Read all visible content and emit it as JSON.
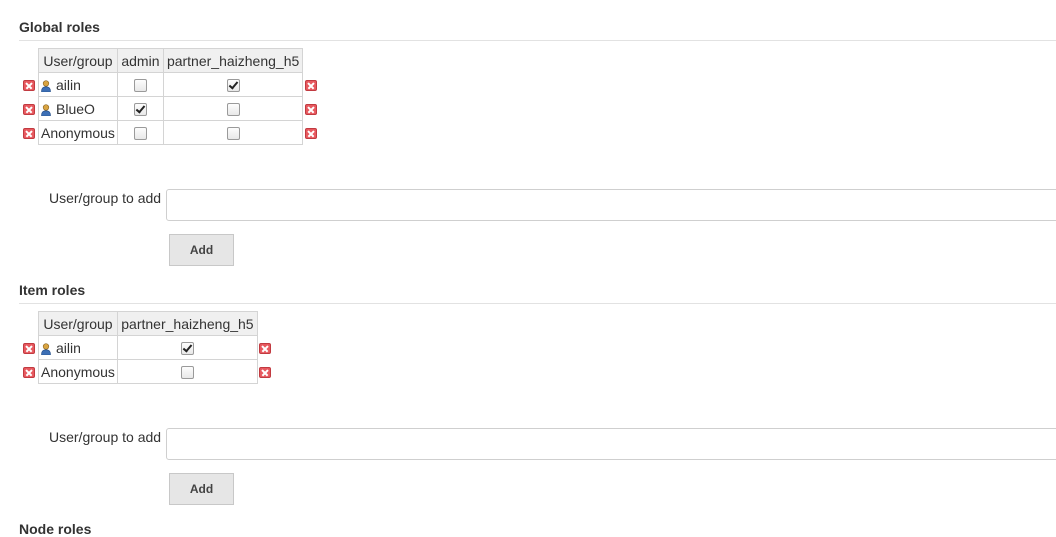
{
  "global": {
    "title": "Global roles",
    "columns": [
      "User/group",
      "admin",
      "partner_haizheng_h5"
    ],
    "rows": [
      {
        "name": "ailin",
        "icon": "user-icon",
        "admin": false,
        "partner": true
      },
      {
        "name": "BlueO",
        "icon": "user-icon",
        "admin": true,
        "partner": false
      },
      {
        "name": "Anonymous",
        "admin": false,
        "partner": false
      }
    ],
    "add_label": "User/group to add",
    "add_input_value": "",
    "add_button": "Add"
  },
  "item": {
    "title": "Item roles",
    "columns": [
      "User/group",
      "partner_haizheng_h5"
    ],
    "rows": [
      {
        "name": "ailin",
        "icon": "user-icon",
        "partner": true
      },
      {
        "name": "Anonymous",
        "partner": false
      }
    ],
    "add_label": "User/group to add",
    "add_input_value": "",
    "add_button": "Add"
  },
  "node": {
    "title": "Node roles"
  },
  "colors": {
    "delete_icon": "#e7595f",
    "header_bg": "#f0f0f0"
  }
}
